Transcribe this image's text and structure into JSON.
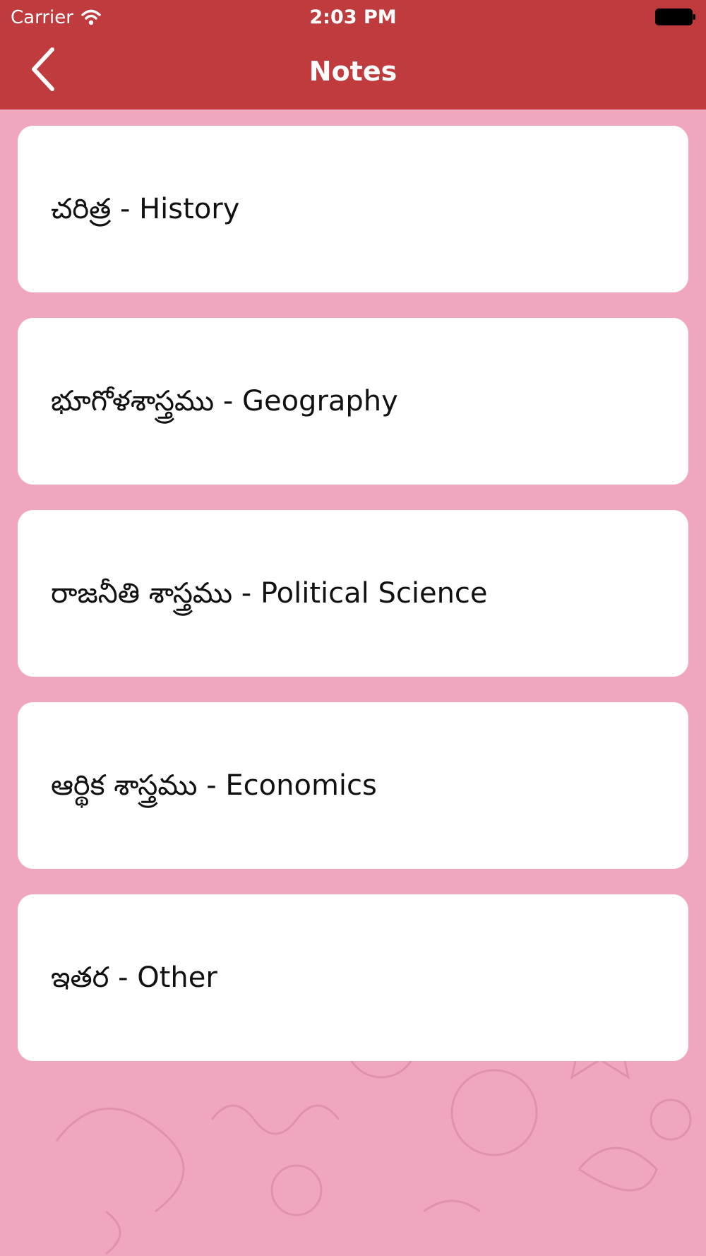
{
  "status_bar": {
    "carrier": "Carrier",
    "time": "2:03 PM"
  },
  "navbar": {
    "title": "Notes",
    "back_icon": "chevron-left-icon",
    "color": "#c03b3e"
  },
  "background": {
    "color": "#f0a6bf"
  },
  "notes": [
    {
      "label": "చరిత్ర - History"
    },
    {
      "label": "భూగోళశాస్త్రము - Geography"
    },
    {
      "label": "రాజనీతి శాస్త్రము - Political Science"
    },
    {
      "label": "ఆర్థిక శాస్త్రము - Economics"
    },
    {
      "label": "ఇతర - Other"
    }
  ]
}
